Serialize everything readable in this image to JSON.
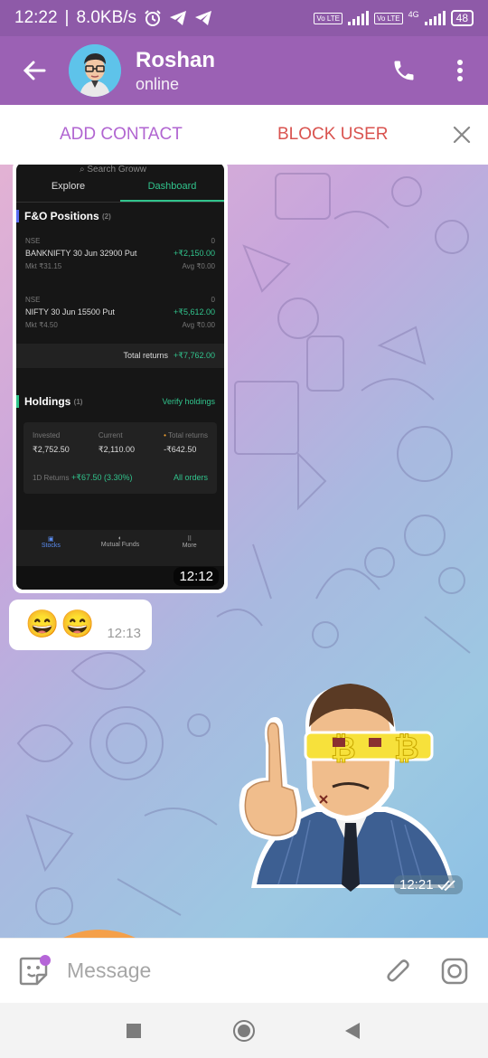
{
  "status_bar": {
    "time": "12:22",
    "speed": "8.0KB/s",
    "volte1": "Vo LTE",
    "volte2": "Vo LTE",
    "network": "4G",
    "battery": "48"
  },
  "header": {
    "contact_name": "Roshan",
    "contact_status": "online"
  },
  "actions": {
    "add_contact": "ADD CONTACT",
    "block_user": "BLOCK USER"
  },
  "messages": {
    "image_message": {
      "time": "12:12",
      "screenshot": {
        "search_placeholder": "Search Groww",
        "tabs": [
          "Explore",
          "Dashboard"
        ],
        "fo_title": "F&O Positions",
        "fo_count": "(2)",
        "positions": [
          {
            "exchange": "NSE",
            "qty": "0",
            "name": "BANKNIFTY 30 Jun 32900 Put",
            "pnl": "+₹2,150.00",
            "mkt": "Mkt ₹31.15",
            "avg": "Avg ₹0.00"
          },
          {
            "exchange": "NSE",
            "qty": "0",
            "name": "NIFTY 30 Jun 15500 Put",
            "pnl": "+₹5,612.00",
            "mkt": "Mkt ₹4.50",
            "avg": "Avg ₹0.00"
          }
        ],
        "total_returns_label": "Total returns",
        "total_returns_value": "+₹7,762.00",
        "holdings_title": "Holdings",
        "holdings_count": "(1)",
        "verify_holdings": "Verify holdings",
        "invested_label": "Invested",
        "invested_value": "₹2,752.50",
        "current_label": "Current",
        "current_value": "₹2,110.00",
        "total_label": "Total returns",
        "total_value": "-₹642.50",
        "day_returns_label": "1D Returns",
        "day_returns_value": "+₹67.50 (3.30%)",
        "all_orders": "All orders",
        "nav": [
          "Stocks",
          "Mutual Funds",
          "More"
        ]
      }
    },
    "emoji_message": {
      "text": "😄😄",
      "time": "12:13"
    },
    "sticker_message": {
      "time": "12:21"
    }
  },
  "input": {
    "placeholder": "Message"
  },
  "colors": {
    "header": "#9b61b4",
    "status_bar": "#8e5aa8",
    "add_contact": "#b165d1",
    "block_user": "#d9534f",
    "groww_green": "#31c48d"
  },
  "icons": {
    "back": "arrow-left-icon",
    "call": "phone-icon",
    "menu": "more-vertical-icon",
    "close": "close-icon",
    "sticker": "sticker-smile-icon",
    "attach": "paperclip-icon",
    "camera": "instagram-camera-icon",
    "read": "double-check-icon"
  }
}
